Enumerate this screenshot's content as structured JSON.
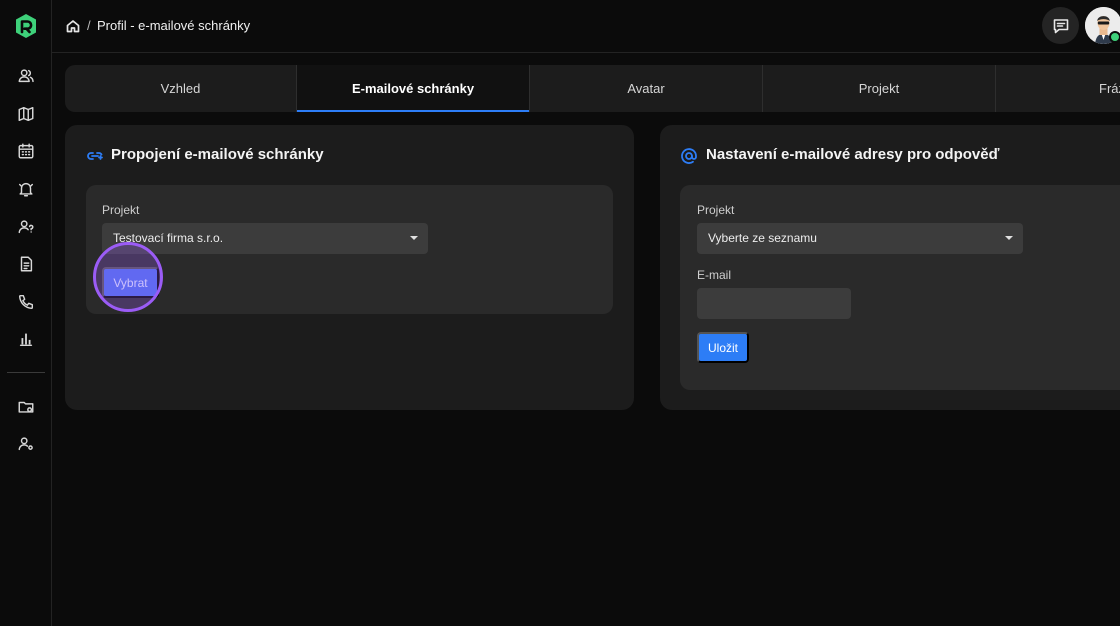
{
  "header": {
    "breadcrumb_separator": "/",
    "breadcrumb_title": "Profil - e-mailové schránky"
  },
  "sidebar": {
    "items": [
      {
        "icon": "users-icon"
      },
      {
        "icon": "map-icon"
      },
      {
        "icon": "calendar-icon"
      },
      {
        "icon": "bell-icon"
      },
      {
        "icon": "user-question-icon"
      },
      {
        "icon": "document-icon"
      },
      {
        "icon": "phone-icon"
      },
      {
        "icon": "bar-chart-icon"
      },
      {
        "icon": "folder-settings-icon"
      },
      {
        "icon": "user-settings-icon"
      }
    ]
  },
  "tabs": [
    {
      "label": "Vzhled",
      "active": false
    },
    {
      "label": "E-mailové schránky",
      "active": true
    },
    {
      "label": "Avatar",
      "active": false
    },
    {
      "label": "Projekt",
      "active": false
    },
    {
      "label": "Fráz",
      "active": false
    }
  ],
  "left_card": {
    "title": "Propojení e-mailové schránky",
    "project_label": "Projekt",
    "project_value": "Testovací firma s.r.o.",
    "select_button": "Vybrat"
  },
  "right_card": {
    "title": "Nastavení e-mailové adresy pro odpověď",
    "project_label": "Projekt",
    "project_value": "Vyberte ze seznamu",
    "email_label": "E-mail",
    "email_value": "",
    "save_button": "Uložit"
  },
  "colors": {
    "accent": "#2d7df6",
    "logo": "#3ed17a",
    "highlight": "#9b5cf6",
    "status_online": "#3ed17a"
  }
}
